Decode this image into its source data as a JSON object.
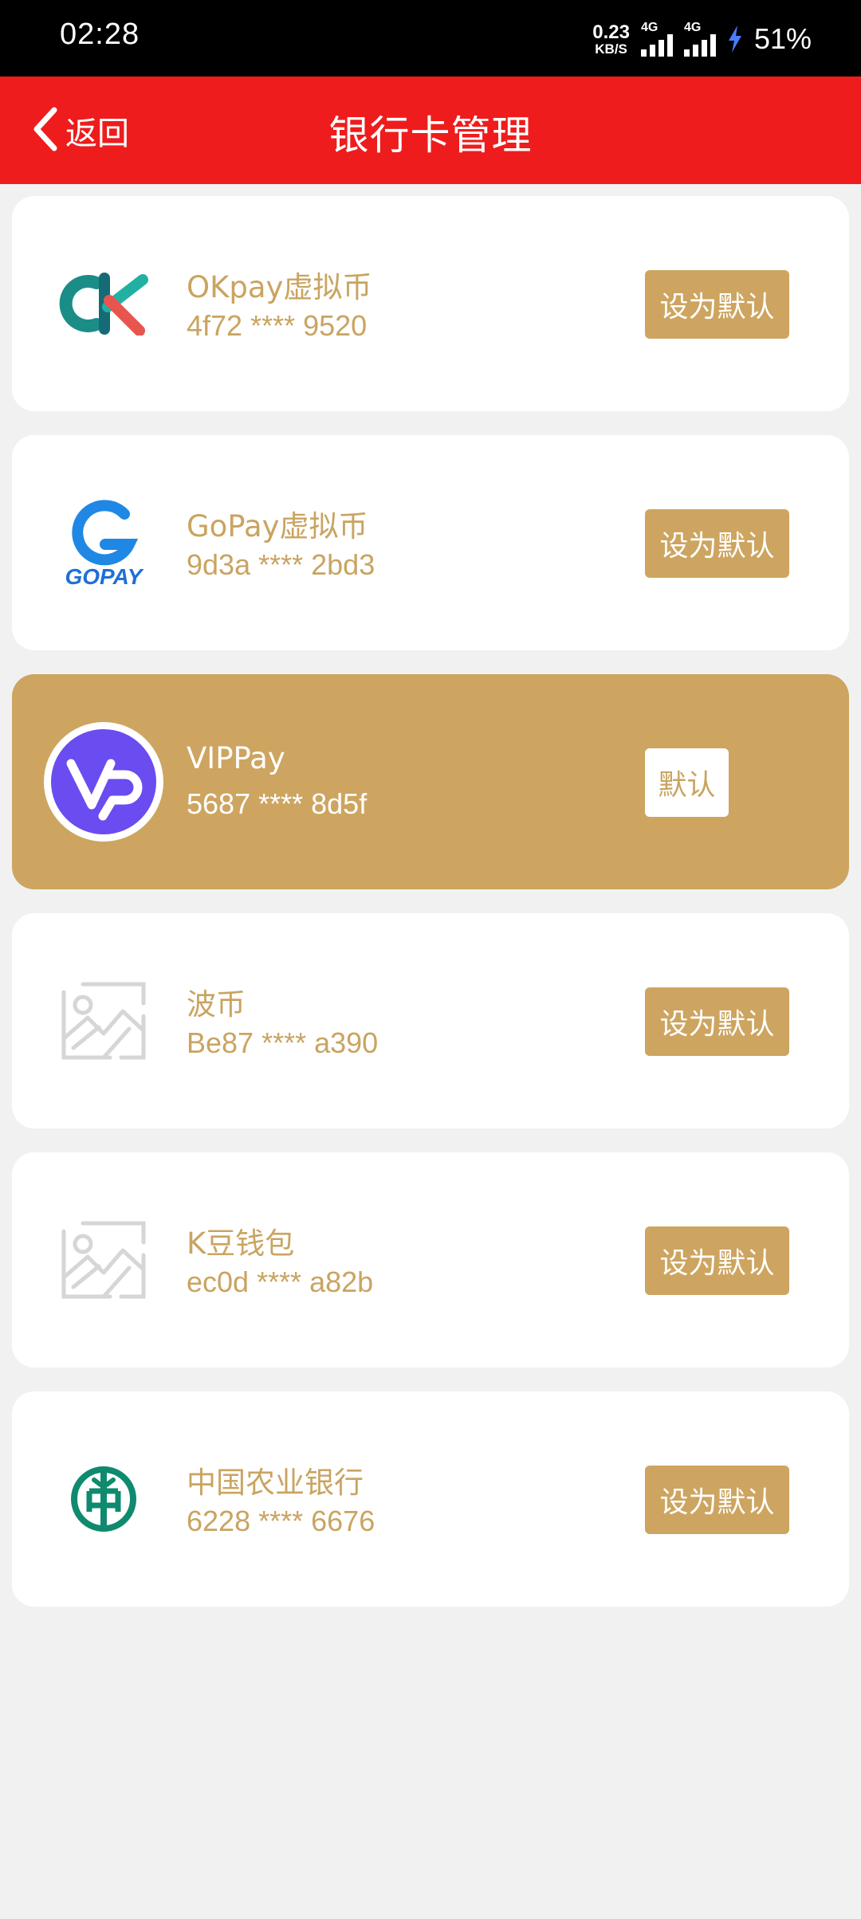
{
  "status_bar": {
    "time": "02:28",
    "net_speed_value": "0.23",
    "net_speed_unit": "KB/S",
    "network_1": "4G",
    "network_2": "4G",
    "battery": "51%"
  },
  "header": {
    "back_label": "返回",
    "title": "银行卡管理"
  },
  "cards": [
    {
      "name": "OKpay虚拟币",
      "number": "4f72 **** 9520",
      "action": "设为默认",
      "logo_icon": "okpay-logo-icon"
    },
    {
      "name": "GoPay虚拟币",
      "number": "9d3a **** 2bd3",
      "action": "设为默认",
      "logo_icon": "gopay-logo-icon",
      "logo_text": "GOPAY"
    },
    {
      "name": "VIPPay",
      "number": "5687 **** 8d5f",
      "badge": "默认",
      "logo_icon": "vippay-logo-icon"
    },
    {
      "name": "波币",
      "number": "Be87 **** a390",
      "action": "设为默认",
      "logo_icon": "image-placeholder-icon"
    },
    {
      "name": "K豆钱包",
      "number": "ec0d **** a82b",
      "action": "设为默认",
      "logo_icon": "image-placeholder-icon"
    },
    {
      "name": "中国农业银行",
      "number": "6228 **** 6676",
      "action": "设为默认",
      "logo_icon": "abc-bank-logo-icon"
    }
  ],
  "colors": {
    "header_bg": "#ee1c1c",
    "accent_gold": "#cda560",
    "page_bg": "#f1f1f1"
  }
}
